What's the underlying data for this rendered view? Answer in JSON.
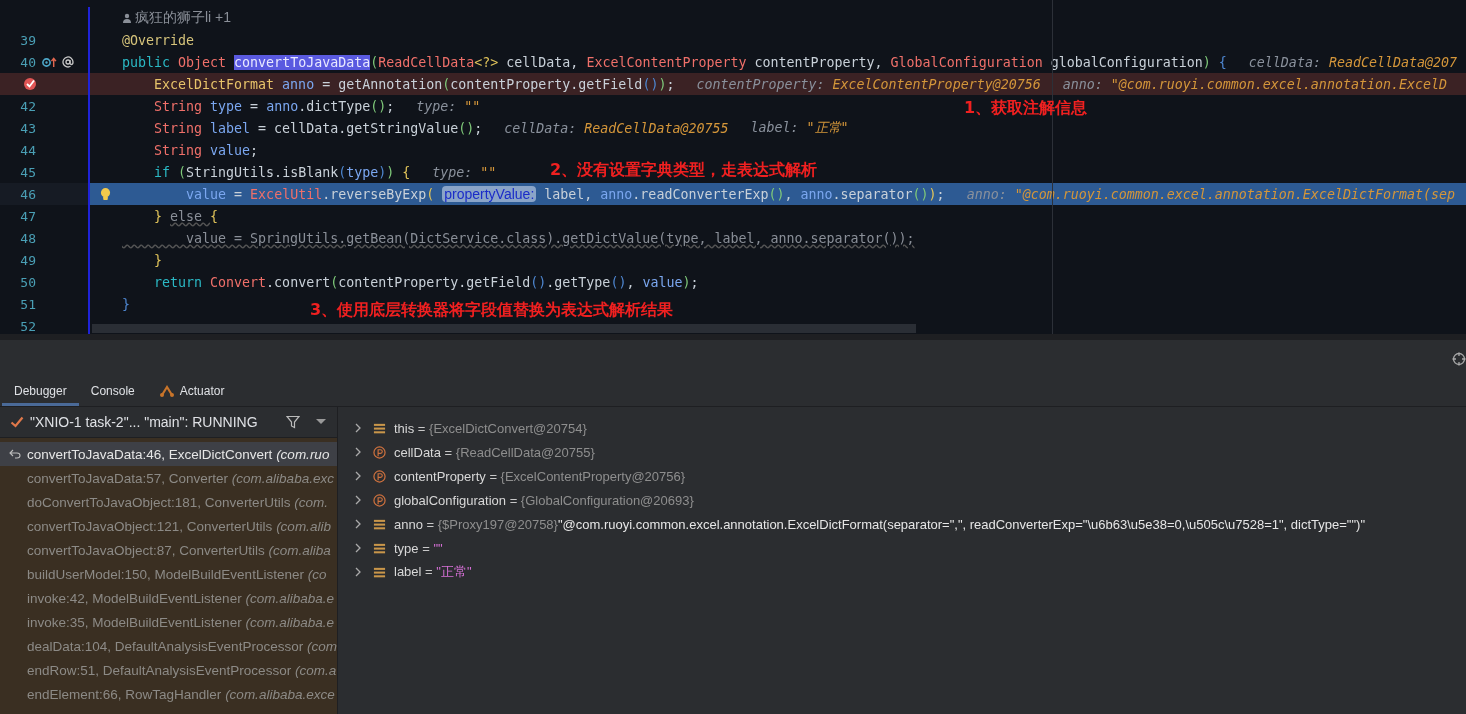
{
  "editor": {
    "author": {
      "name": "疯狂的狮子li",
      "extra": "+1"
    },
    "lines": [
      {
        "number": "39",
        "kind": "plain",
        "tokens": [
          {
            "kind": "ann",
            "text": "@Override"
          }
        ]
      },
      {
        "number": "40",
        "kind": "override",
        "tokens": [
          {
            "kind": "kw",
            "text": "public "
          },
          {
            "kind": "type",
            "text": "Object "
          },
          {
            "kind": "sel",
            "text": "convertToJavaData"
          },
          {
            "kind": "p1",
            "text": "("
          },
          {
            "kind": "type",
            "text": "ReadCellData"
          },
          {
            "kind": "p3",
            "text": "<?> "
          },
          {
            "kind": "plain",
            "text": "cellData, "
          },
          {
            "kind": "type",
            "text": "ExcelContentProperty "
          },
          {
            "kind": "plain",
            "text": "contentProperty, "
          },
          {
            "kind": "type",
            "text": "GlobalConfiguration "
          },
          {
            "kind": "plain",
            "text": "globalConfiguration"
          },
          {
            "kind": "p1",
            "text": ")"
          },
          {
            "kind": "p2",
            "text": " {"
          }
        ],
        "hints": [
          {
            "label": "cellData:",
            "value": "ReadCellData@207"
          }
        ]
      },
      {
        "kind": "breakpoint",
        "tokens": [
          {
            "kind": "type2",
            "text": "    ExcelDictFormat "
          },
          {
            "kind": "var",
            "text": "anno"
          },
          {
            "kind": "plain",
            "text": " = getAnnotation"
          },
          {
            "kind": "p1",
            "text": "("
          },
          {
            "kind": "plain",
            "text": "contentProperty.getField"
          },
          {
            "kind": "p2",
            "text": "()"
          },
          {
            "kind": "p1",
            "text": ")"
          },
          {
            "kind": "plain",
            "text": ";"
          }
        ],
        "hints": [
          {
            "label": "contentProperty:",
            "value": "ExcelContentProperty@20756"
          },
          {
            "label": "anno:",
            "value": "\"@com.ruoyi.common.excel.annotation.ExcelD"
          }
        ]
      },
      {
        "number": "42",
        "kind": "plain",
        "tokens": [
          {
            "kind": "type",
            "text": "    String "
          },
          {
            "kind": "var",
            "text": "type"
          },
          {
            "kind": "plain",
            "text": " = "
          },
          {
            "kind": "var",
            "text": "anno"
          },
          {
            "kind": "plain",
            "text": ".dictType"
          },
          {
            "kind": "p1",
            "text": "()"
          },
          {
            "kind": "plain",
            "text": ";"
          }
        ],
        "hints": [
          {
            "label": "type:",
            "value": "\"\""
          }
        ]
      },
      {
        "number": "43",
        "kind": "plain",
        "tokens": [
          {
            "kind": "type",
            "text": "    String "
          },
          {
            "kind": "var",
            "text": "label"
          },
          {
            "kind": "plain",
            "text": " = cellData.getStringValue"
          },
          {
            "kind": "p1",
            "text": "()"
          },
          {
            "kind": "plain",
            "text": ";"
          }
        ],
        "hints": [
          {
            "label": "cellData:",
            "value": "ReadCellData@20755"
          },
          {
            "label": "label:",
            "value": "\"正常\""
          }
        ]
      },
      {
        "number": "44",
        "kind": "plain",
        "tokens": [
          {
            "kind": "type",
            "text": "    String "
          },
          {
            "kind": "var",
            "text": "value"
          },
          {
            "kind": "plain",
            "text": ";"
          }
        ]
      },
      {
        "number": "45",
        "kind": "plain",
        "tokens": [
          {
            "kind": "kw",
            "text": "    if "
          },
          {
            "kind": "p1",
            "text": "("
          },
          {
            "kind": "plain",
            "text": "StringUtils.isBlank"
          },
          {
            "kind": "p2",
            "text": "("
          },
          {
            "kind": "var",
            "text": "type"
          },
          {
            "kind": "p2",
            "text": ")"
          },
          {
            "kind": "p1",
            "text": ")"
          },
          {
            "kind": "p3",
            "text": " {"
          }
        ],
        "hints": [
          {
            "label": "type:",
            "value": "\"\""
          }
        ]
      },
      {
        "number": "46",
        "kind": "current",
        "tokens": [
          {
            "kind": "var",
            "text": "        value"
          },
          {
            "kind": "plain",
            "text": " = "
          },
          {
            "kind": "type",
            "text": "ExcelUtil"
          },
          {
            "kind": "plain",
            "text": ".reverseByExp"
          },
          {
            "kind": "p3",
            "text": "( "
          },
          {
            "kind": "phint",
            "text": "propertyValue:"
          },
          {
            "kind": "plain",
            "text": " label, "
          },
          {
            "kind": "var",
            "text": "anno"
          },
          {
            "kind": "plain",
            "text": ".readConverterExp"
          },
          {
            "kind": "p1",
            "text": "()"
          },
          {
            "kind": "plain",
            "text": ", "
          },
          {
            "kind": "var",
            "text": "anno"
          },
          {
            "kind": "plain",
            "text": ".separator"
          },
          {
            "kind": "p1",
            "text": "()"
          },
          {
            "kind": "p3",
            "text": ")"
          },
          {
            "kind": "plain",
            "text": ";"
          }
        ],
        "hints": [
          {
            "label": "anno:",
            "value": "\"@com.ruoyi.common.excel.annotation.ExcelDictFormat(sep"
          }
        ]
      },
      {
        "number": "47",
        "kind": "plain",
        "tokens": [
          {
            "kind": "p3",
            "text": "    } "
          },
          {
            "kind": "dim",
            "text": "else "
          },
          {
            "kind": "p3",
            "text": "{"
          }
        ]
      },
      {
        "number": "48",
        "kind": "plain",
        "tokens": [
          {
            "kind": "dim",
            "text": "        value = SpringUtils.getBean(DictService.class).getDictValue(type, label, anno.separator());"
          }
        ]
      },
      {
        "number": "49",
        "kind": "plain",
        "tokens": [
          {
            "kind": "p3",
            "text": "    }"
          }
        ]
      },
      {
        "number": "50",
        "kind": "plain",
        "tokens": [
          {
            "kind": "kw",
            "text": "    return "
          },
          {
            "kind": "type",
            "text": "Convert"
          },
          {
            "kind": "plain",
            "text": ".convert"
          },
          {
            "kind": "p1",
            "text": "("
          },
          {
            "kind": "plain",
            "text": "contentProperty.getField"
          },
          {
            "kind": "p2",
            "text": "()"
          },
          {
            "kind": "plain",
            "text": ".getType"
          },
          {
            "kind": "p2",
            "text": "()"
          },
          {
            "kind": "plain",
            "text": ", "
          },
          {
            "kind": "var",
            "text": "value"
          },
          {
            "kind": "p1",
            "text": ")"
          },
          {
            "kind": "plain",
            "text": ";"
          }
        ]
      },
      {
        "number": "51",
        "kind": "plain",
        "tokens": [
          {
            "kind": "p2",
            "text": "}"
          }
        ]
      },
      {
        "number": "52",
        "kind": "plain"
      }
    ],
    "notes": [
      "1、获取注解信息",
      "2、没有设置字典类型，走表达式解析",
      "3、使用底层转换器将字段值替换为表达式解析结果"
    ]
  },
  "debug": {
    "tabs": [
      {
        "label": "Debugger",
        "selected": true
      },
      {
        "label": "Console",
        "selected": false
      },
      {
        "label": "Actuator",
        "selected": false
      }
    ],
    "thread": "\"XNIO-1 task-2\"... \"main\": RUNNING",
    "frames": [
      {
        "text": "convertToJavaData:46, ExcelDictConvert *(com.ruo*",
        "selected": true
      },
      {
        "text": "convertToJavaData:57, Converter *(com.alibaba.exc*",
        "selected": false
      },
      {
        "text": "doConvertToJavaObject:181, ConverterUtils *(com.*",
        "selected": false
      },
      {
        "text": "convertToJavaObject:121, ConverterUtils *(com.alib*",
        "selected": false
      },
      {
        "text": "convertToJavaObject:87, ConverterUtils *(com.aliba*",
        "selected": false
      },
      {
        "text": "buildUserModel:150, ModelBuildEventListener *(co*",
        "selected": false
      },
      {
        "text": "invoke:42, ModelBuildEventListener *(com.alibaba.e*",
        "selected": false
      },
      {
        "text": "invoke:35, ModelBuildEventListener *(com.alibaba.e*",
        "selected": false
      },
      {
        "text": "dealData:104, DefaultAnalysisEventProcessor *(com*",
        "selected": false
      },
      {
        "text": "endRow:51, DefaultAnalysisEventProcessor *(com.a*",
        "selected": false
      },
      {
        "text": "endElement:66, RowTagHandler *(com.alibaba.exce*",
        "selected": false
      }
    ],
    "variables": [
      {
        "kind": "field",
        "name": "this",
        "op": "=",
        "ref": "{ExcelDictConvert@20754}"
      },
      {
        "kind": "param",
        "name": "cellData",
        "op": "=",
        "ref": "{ReadCellData@20755}"
      },
      {
        "kind": "param",
        "name": "contentProperty",
        "op": "=",
        "ref": "{ExcelContentProperty@20756}"
      },
      {
        "kind": "param",
        "name": "globalConfiguration",
        "op": "=",
        "ref": "{GlobalConfiguration@20693}"
      },
      {
        "kind": "field",
        "name": "anno",
        "op": "=",
        "ref": "{$Proxy197@20758}",
        "value": {
          "kind": "text",
          "text": "\"@com.ruoyi.common.excel.annotation.ExcelDictFormat(separator=\",\", readConverterExp=\"\\u6b63\\u5e38=0,\\u505c\\u7528=1\", dictType=\"\")\""
        }
      },
      {
        "kind": "field",
        "name": "type",
        "op": "=",
        "value": {
          "kind": "string",
          "text": "\"\""
        }
      },
      {
        "kind": "field",
        "name": "label",
        "op": "=",
        "value": {
          "kind": "string",
          "text": "\"正常\""
        }
      }
    ]
  }
}
